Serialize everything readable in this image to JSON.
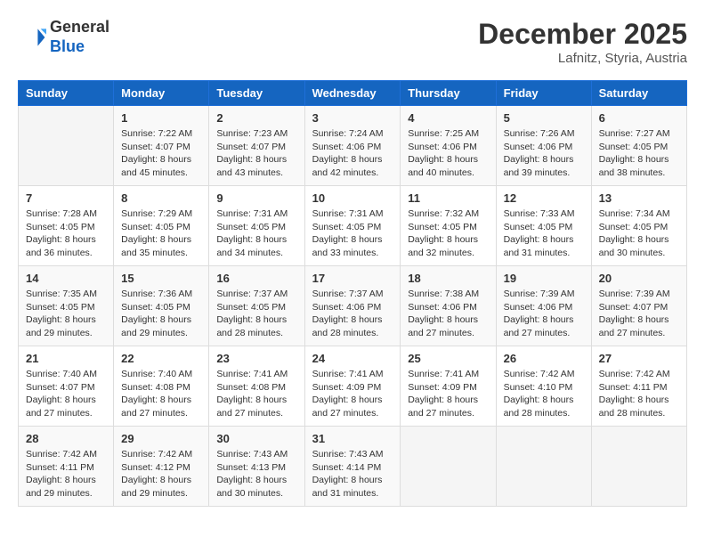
{
  "header": {
    "logo_general": "General",
    "logo_blue": "Blue",
    "month_title": "December 2025",
    "location": "Lafnitz, Styria, Austria"
  },
  "weekdays": [
    "Sunday",
    "Monday",
    "Tuesday",
    "Wednesday",
    "Thursday",
    "Friday",
    "Saturday"
  ],
  "weeks": [
    [
      {
        "day": "",
        "info": ""
      },
      {
        "day": "1",
        "info": "Sunrise: 7:22 AM\nSunset: 4:07 PM\nDaylight: 8 hours\nand 45 minutes."
      },
      {
        "day": "2",
        "info": "Sunrise: 7:23 AM\nSunset: 4:07 PM\nDaylight: 8 hours\nand 43 minutes."
      },
      {
        "day": "3",
        "info": "Sunrise: 7:24 AM\nSunset: 4:06 PM\nDaylight: 8 hours\nand 42 minutes."
      },
      {
        "day": "4",
        "info": "Sunrise: 7:25 AM\nSunset: 4:06 PM\nDaylight: 8 hours\nand 40 minutes."
      },
      {
        "day": "5",
        "info": "Sunrise: 7:26 AM\nSunset: 4:06 PM\nDaylight: 8 hours\nand 39 minutes."
      },
      {
        "day": "6",
        "info": "Sunrise: 7:27 AM\nSunset: 4:05 PM\nDaylight: 8 hours\nand 38 minutes."
      }
    ],
    [
      {
        "day": "7",
        "info": "Sunrise: 7:28 AM\nSunset: 4:05 PM\nDaylight: 8 hours\nand 36 minutes."
      },
      {
        "day": "8",
        "info": "Sunrise: 7:29 AM\nSunset: 4:05 PM\nDaylight: 8 hours\nand 35 minutes."
      },
      {
        "day": "9",
        "info": "Sunrise: 7:31 AM\nSunset: 4:05 PM\nDaylight: 8 hours\nand 34 minutes."
      },
      {
        "day": "10",
        "info": "Sunrise: 7:31 AM\nSunset: 4:05 PM\nDaylight: 8 hours\nand 33 minutes."
      },
      {
        "day": "11",
        "info": "Sunrise: 7:32 AM\nSunset: 4:05 PM\nDaylight: 8 hours\nand 32 minutes."
      },
      {
        "day": "12",
        "info": "Sunrise: 7:33 AM\nSunset: 4:05 PM\nDaylight: 8 hours\nand 31 minutes."
      },
      {
        "day": "13",
        "info": "Sunrise: 7:34 AM\nSunset: 4:05 PM\nDaylight: 8 hours\nand 30 minutes."
      }
    ],
    [
      {
        "day": "14",
        "info": "Sunrise: 7:35 AM\nSunset: 4:05 PM\nDaylight: 8 hours\nand 29 minutes."
      },
      {
        "day": "15",
        "info": "Sunrise: 7:36 AM\nSunset: 4:05 PM\nDaylight: 8 hours\nand 29 minutes."
      },
      {
        "day": "16",
        "info": "Sunrise: 7:37 AM\nSunset: 4:05 PM\nDaylight: 8 hours\nand 28 minutes."
      },
      {
        "day": "17",
        "info": "Sunrise: 7:37 AM\nSunset: 4:06 PM\nDaylight: 8 hours\nand 28 minutes."
      },
      {
        "day": "18",
        "info": "Sunrise: 7:38 AM\nSunset: 4:06 PM\nDaylight: 8 hours\nand 27 minutes."
      },
      {
        "day": "19",
        "info": "Sunrise: 7:39 AM\nSunset: 4:06 PM\nDaylight: 8 hours\nand 27 minutes."
      },
      {
        "day": "20",
        "info": "Sunrise: 7:39 AM\nSunset: 4:07 PM\nDaylight: 8 hours\nand 27 minutes."
      }
    ],
    [
      {
        "day": "21",
        "info": "Sunrise: 7:40 AM\nSunset: 4:07 PM\nDaylight: 8 hours\nand 27 minutes."
      },
      {
        "day": "22",
        "info": "Sunrise: 7:40 AM\nSunset: 4:08 PM\nDaylight: 8 hours\nand 27 minutes."
      },
      {
        "day": "23",
        "info": "Sunrise: 7:41 AM\nSunset: 4:08 PM\nDaylight: 8 hours\nand 27 minutes."
      },
      {
        "day": "24",
        "info": "Sunrise: 7:41 AM\nSunset: 4:09 PM\nDaylight: 8 hours\nand 27 minutes."
      },
      {
        "day": "25",
        "info": "Sunrise: 7:41 AM\nSunset: 4:09 PM\nDaylight: 8 hours\nand 27 minutes."
      },
      {
        "day": "26",
        "info": "Sunrise: 7:42 AM\nSunset: 4:10 PM\nDaylight: 8 hours\nand 28 minutes."
      },
      {
        "day": "27",
        "info": "Sunrise: 7:42 AM\nSunset: 4:11 PM\nDaylight: 8 hours\nand 28 minutes."
      }
    ],
    [
      {
        "day": "28",
        "info": "Sunrise: 7:42 AM\nSunset: 4:11 PM\nDaylight: 8 hours\nand 29 minutes."
      },
      {
        "day": "29",
        "info": "Sunrise: 7:42 AM\nSunset: 4:12 PM\nDaylight: 8 hours\nand 29 minutes."
      },
      {
        "day": "30",
        "info": "Sunrise: 7:43 AM\nSunset: 4:13 PM\nDaylight: 8 hours\nand 30 minutes."
      },
      {
        "day": "31",
        "info": "Sunrise: 7:43 AM\nSunset: 4:14 PM\nDaylight: 8 hours\nand 31 minutes."
      },
      {
        "day": "",
        "info": ""
      },
      {
        "day": "",
        "info": ""
      },
      {
        "day": "",
        "info": ""
      }
    ]
  ]
}
